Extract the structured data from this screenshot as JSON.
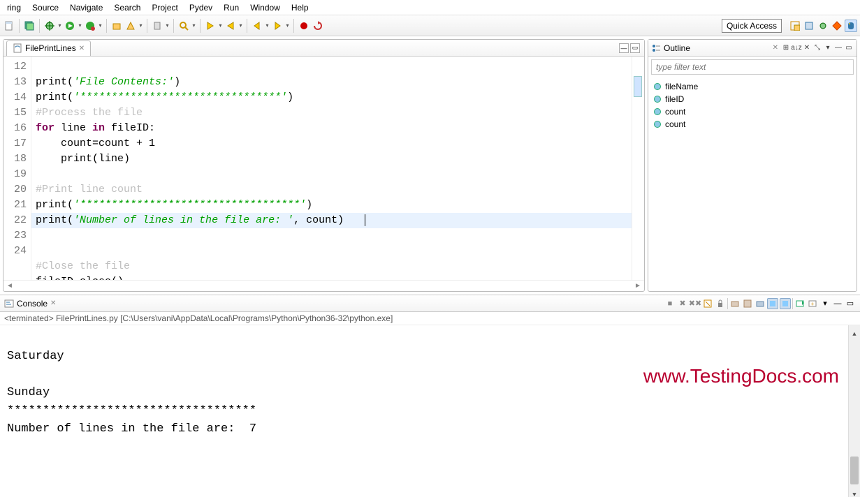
{
  "menu": {
    "items": [
      "ring",
      "Source",
      "Navigate",
      "Search",
      "Project",
      "Pydev",
      "Run",
      "Window",
      "Help"
    ]
  },
  "quick_access": "Quick Access",
  "editor": {
    "tab_title": "FilePrintLines",
    "lines": {
      "12": {
        "n": "12"
      },
      "13": {
        "n": "13"
      },
      "14": {
        "n": "14"
      },
      "15": {
        "n": "15"
      },
      "16": {
        "n": "16"
      },
      "17": {
        "n": "17"
      },
      "18": {
        "n": "18"
      },
      "19": {
        "n": "19"
      },
      "20": {
        "n": "20"
      },
      "21": {
        "n": "21"
      },
      "22": {
        "n": "22"
      },
      "23": {
        "n": "23"
      },
      "24": {
        "n": "24"
      }
    },
    "code": {
      "l12_str": "'File Contents:'",
      "l13_str": "'********************************'",
      "l14_cmt": "#Process the file",
      "l15_for": "for",
      "l15_line": " line ",
      "l15_in": "in",
      "l15_fileid": " fileID:",
      "l16": "    count=count + 1",
      "l17_print": "print",
      "l17_line": "(line)",
      "l19_cmt": "#Print line count",
      "l20_str": "'***********************************'",
      "l21_str": "'Number of lines in the file are: '",
      "l21_rest": ", count)",
      "l23_cmt": "#Close the file",
      "l24": "fileID.close()",
      "print": "print"
    }
  },
  "outline": {
    "title": "Outline",
    "filter_placeholder": "type filter text",
    "items": [
      "fileName",
      "fileID",
      "count",
      "count"
    ]
  },
  "console": {
    "title": "Console",
    "sub": "<terminated> FilePrintLines.py [C:\\Users\\vani\\AppData\\Local\\Programs\\Python\\Python36-32\\python.exe]",
    "out_l1": "Saturday",
    "out_l2": "",
    "out_l3": "Sunday",
    "out_l4": "***********************************",
    "out_l5": "Number of lines in the file are:  7"
  },
  "watermark": "www.TestingDocs.com"
}
